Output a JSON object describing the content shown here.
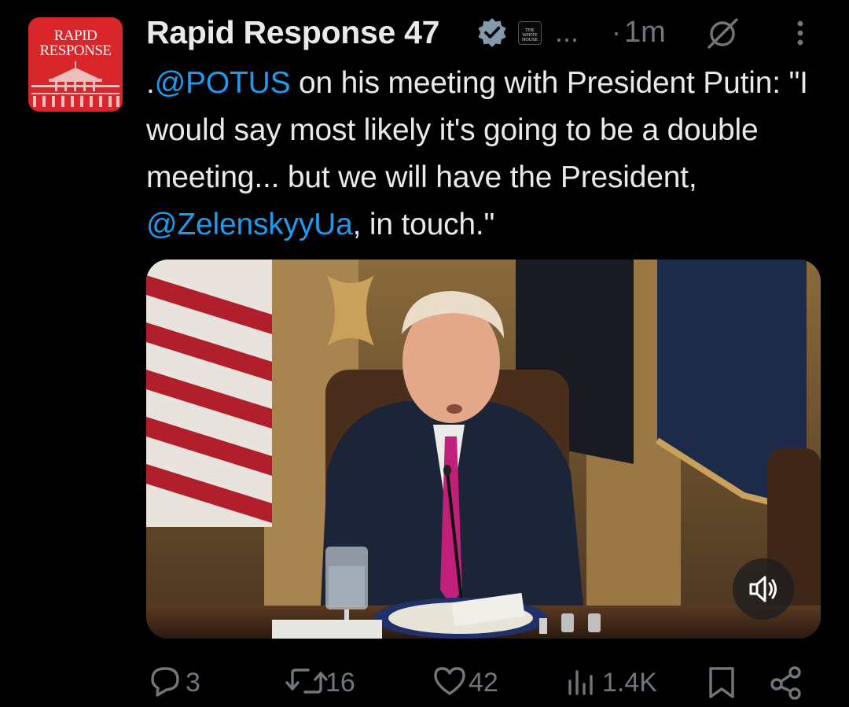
{
  "account": {
    "avatar_text": "RAPID\nRESPONSE",
    "name": "Rapid Response 47",
    "affiliation_badge_text": "THE\nWHITE\nHOUSE",
    "ellipsis": "...",
    "separator": "·",
    "timestamp": "1m"
  },
  "tweet": {
    "prefix": ".",
    "mention_1": "@POTUS",
    "part_1": " on his meeting with President Putin: \"I would say most likely it's going to be a double meeting... but we will have the President, ",
    "mention_2": "@ZelenskyyUa",
    "part_2": ", in touch.\""
  },
  "media": {
    "type": "video",
    "volume_icon": "speaker-muted-icon"
  },
  "actions": {
    "replies": "3",
    "reposts": "16",
    "likes": "42",
    "views": "1.4K"
  },
  "colors": {
    "background": "#000000",
    "text": "#e7e9ea",
    "secondary": "#71767b",
    "link": "#1d9bf0",
    "verified": "#829aab",
    "avatar": "#d8262b"
  }
}
